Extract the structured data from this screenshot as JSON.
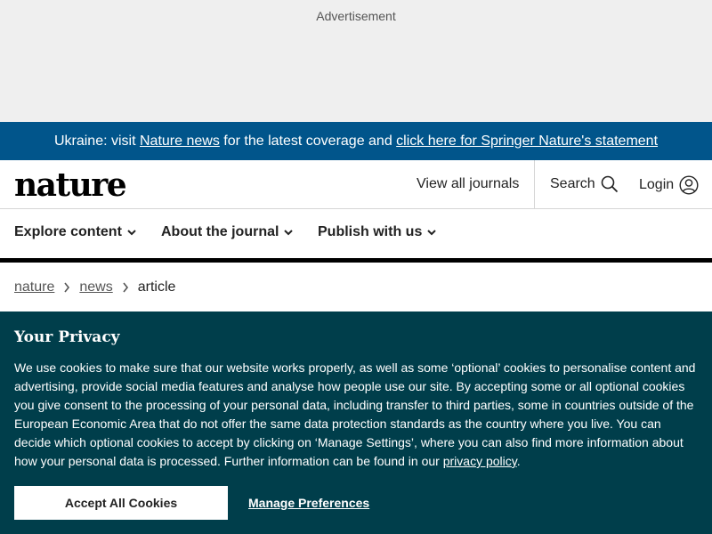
{
  "ad": {
    "label": "Advertisement"
  },
  "banner": {
    "prefix": "Ukraine: visit ",
    "link1": "Nature news",
    "middle": " for the latest coverage and ",
    "link2": "click here for Springer Nature's statement"
  },
  "header": {
    "logo": "nature",
    "view_all": "View all journals",
    "search": "Search",
    "login": "Login"
  },
  "nav": {
    "items": [
      {
        "label": "Explore content"
      },
      {
        "label": "About the journal"
      },
      {
        "label": "Publish with us"
      }
    ]
  },
  "breadcrumb": {
    "items": [
      "nature",
      "news"
    ],
    "current": "article"
  },
  "cookie": {
    "title": "Your Privacy",
    "body": "We use cookies to make sure that our website works properly, as well as some ‘optional’ cookies to personalise content and advertising, provide social media features and analyse how people use our site. By accepting some or all optional cookies you give consent to the processing of your personal data, including transfer to third parties, some in countries outside of the European Economic Area that do not offer the same data protection standards as the country where you live. You can decide which optional cookies to accept by clicking on ‘Manage Settings’, where you can also find more information about how your personal data is processed. Further information can be found in our ",
    "privacy_link": "privacy policy",
    "body_end": ".",
    "accept": "Accept All Cookies",
    "manage": "Manage Preferences"
  },
  "colors": {
    "banner_bg": "#01558b",
    "cookie_bg": "#003e4b",
    "ad_bg": "#efefef"
  }
}
